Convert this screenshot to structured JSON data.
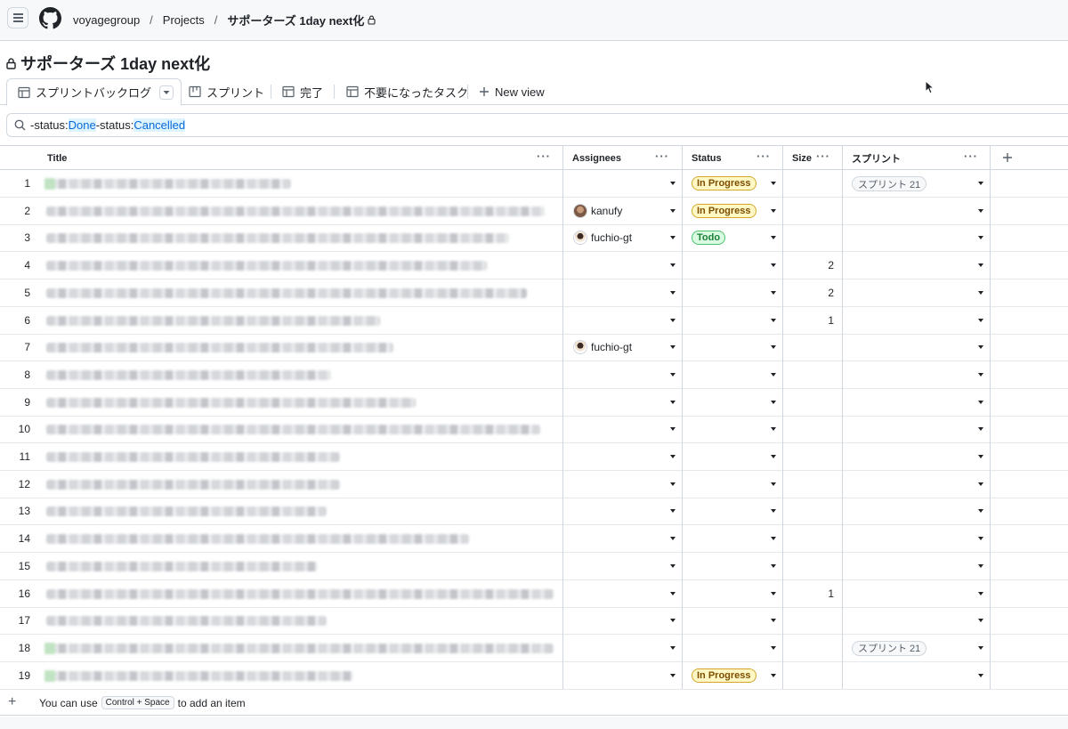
{
  "header": {
    "breadcrumbs": [
      {
        "label": "voyagegroup"
      },
      {
        "label": "Projects"
      },
      {
        "label": "サポーターズ 1day next化"
      }
    ]
  },
  "project": {
    "title": "サポーターズ 1day next化"
  },
  "tabs": [
    {
      "label": "スプリントバックログ",
      "icon": "table-icon",
      "active": true
    },
    {
      "label": "スプリント",
      "icon": "board-icon",
      "active": false
    },
    {
      "label": "完了",
      "icon": "table-icon",
      "active": false
    },
    {
      "label": "不要になったタスク",
      "icon": "table-icon",
      "active": false
    },
    {
      "label": "New view",
      "icon": "plus-icon",
      "active": false
    }
  ],
  "filter": {
    "prefix1": "-status:",
    "value1": "Done",
    "prefix2": " -status:",
    "value2": "Cancelled"
  },
  "columns": [
    "Title",
    "Assignees",
    "Status",
    "Size",
    "スプリント"
  ],
  "rows": [
    {
      "num": "1",
      "assignee": "",
      "status": "In Progress",
      "size": "",
      "sprint": "スプリント 21"
    },
    {
      "num": "2",
      "assignee": "kanufy",
      "status": "In Progress",
      "size": "",
      "sprint": ""
    },
    {
      "num": "3",
      "assignee": "fuchio-gt",
      "status": "Todo",
      "size": "",
      "sprint": ""
    },
    {
      "num": "4",
      "assignee": "",
      "status": "",
      "size": "2",
      "sprint": ""
    },
    {
      "num": "5",
      "assignee": "",
      "status": "",
      "size": "2",
      "sprint": ""
    },
    {
      "num": "6",
      "assignee": "",
      "status": "",
      "size": "1",
      "sprint": ""
    },
    {
      "num": "7",
      "assignee": "fuchio-gt",
      "status": "",
      "size": "",
      "sprint": ""
    },
    {
      "num": "8",
      "assignee": "",
      "status": "",
      "size": "",
      "sprint": ""
    },
    {
      "num": "9",
      "assignee": "",
      "status": "",
      "size": "",
      "sprint": ""
    },
    {
      "num": "10",
      "assignee": "",
      "status": "",
      "size": "",
      "sprint": ""
    },
    {
      "num": "11",
      "assignee": "",
      "status": "",
      "size": "",
      "sprint": ""
    },
    {
      "num": "12",
      "assignee": "",
      "status": "",
      "size": "",
      "sprint": ""
    },
    {
      "num": "13",
      "assignee": "",
      "status": "",
      "size": "",
      "sprint": ""
    },
    {
      "num": "14",
      "assignee": "",
      "status": "",
      "size": "",
      "sprint": ""
    },
    {
      "num": "15",
      "assignee": "",
      "status": "",
      "size": "",
      "sprint": ""
    },
    {
      "num": "16",
      "assignee": "",
      "status": "",
      "size": "1",
      "sprint": ""
    },
    {
      "num": "17",
      "assignee": "",
      "status": "",
      "size": "",
      "sprint": ""
    },
    {
      "num": "18",
      "assignee": "",
      "status": "",
      "size": "",
      "sprint": "スプリント 21"
    },
    {
      "num": "19",
      "assignee": "",
      "status": "In Progress",
      "size": "",
      "sprint": ""
    }
  ],
  "footer": {
    "hint_before": "You can use",
    "hint_key": "Control + Space",
    "hint_after": "to add an item"
  },
  "colors": {
    "in_progress": "#fff8c5",
    "todo": "#dafbe1",
    "filter_highlight": "#0969da"
  }
}
